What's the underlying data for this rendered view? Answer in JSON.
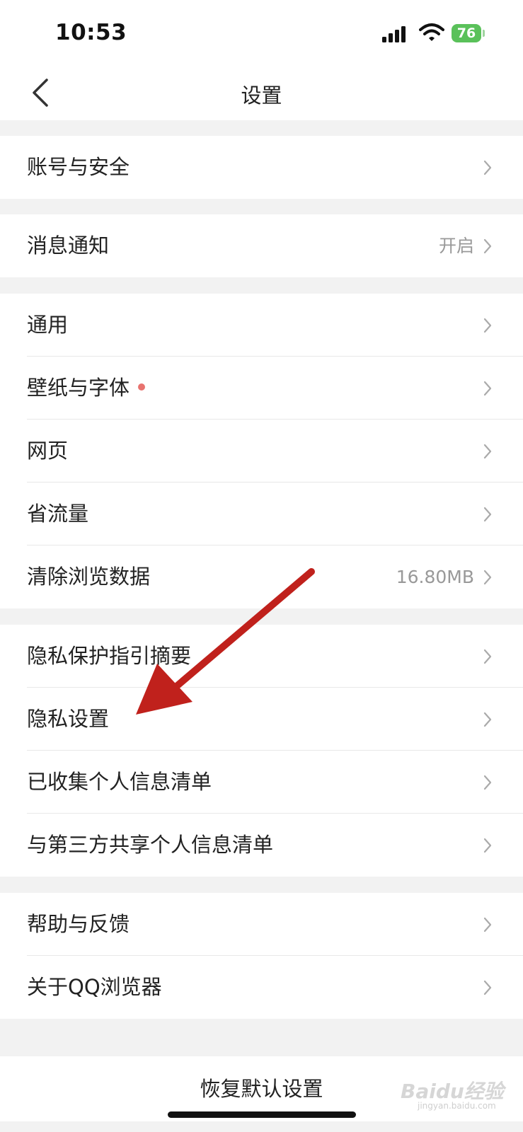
{
  "status_bar": {
    "time": "10:53",
    "battery": "76"
  },
  "nav": {
    "title": "设置"
  },
  "groups": [
    [
      {
        "label": "账号与安全",
        "value": ""
      }
    ],
    [
      {
        "label": "消息通知",
        "value": "开启"
      }
    ],
    [
      {
        "label": "通用",
        "value": ""
      },
      {
        "label": "壁纸与字体",
        "value": ""
      },
      {
        "label": "网页",
        "value": ""
      },
      {
        "label": "省流量",
        "value": ""
      },
      {
        "label": "清除浏览数据",
        "value": "16.80MB"
      }
    ],
    [
      {
        "label": "隐私保护指引摘要",
        "value": ""
      },
      {
        "label": "隐私设置",
        "value": ""
      },
      {
        "label": "已收集个人信息清单",
        "value": ""
      },
      {
        "label": "与第三方共享个人信息清单",
        "value": ""
      }
    ],
    [
      {
        "label": "帮助与反馈",
        "value": ""
      },
      {
        "label": "关于QQ浏览器",
        "value": ""
      }
    ]
  ],
  "reset": {
    "label": "恢复默认设置"
  },
  "watermark": {
    "text": "Baidu经验",
    "sub": "jingyan.baidu.com"
  },
  "colors": {
    "background": "#f2f2f2",
    "accent_dot": "#e8736f",
    "battery": "#5ac15a",
    "arrow": "#c0211c"
  }
}
